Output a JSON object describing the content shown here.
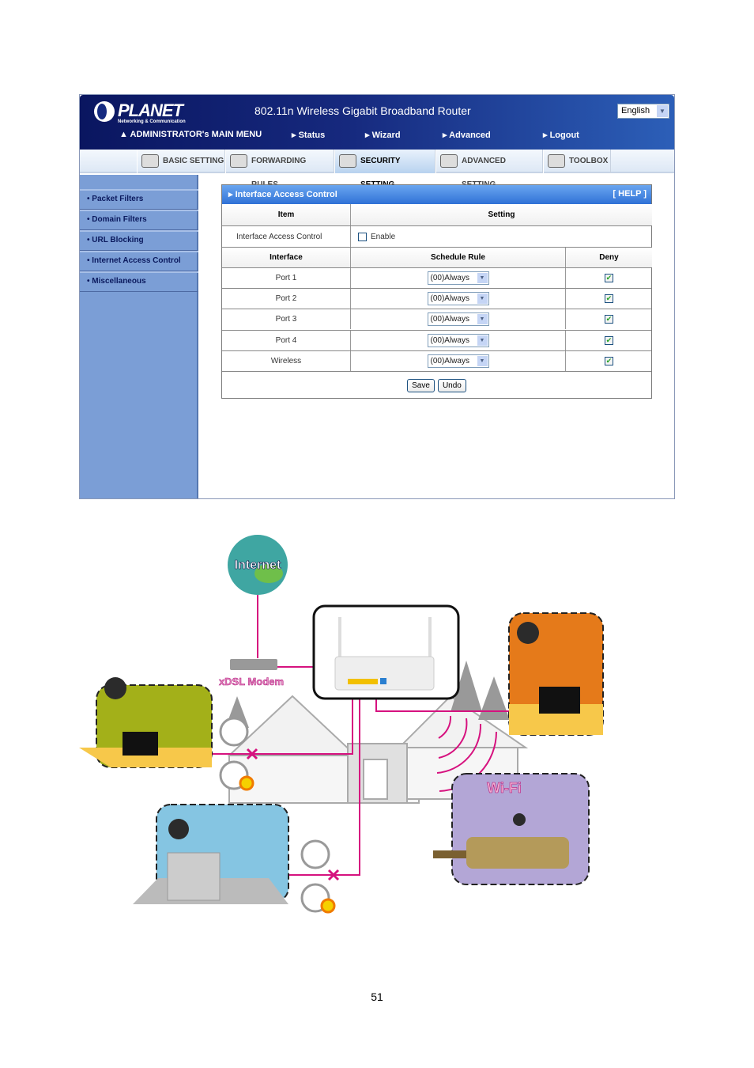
{
  "router_ui": {
    "brand": "PLANET",
    "brand_tagline": "Networking & Communication",
    "title": "802.11n Wireless Gigabit Broadband Router",
    "language": "English",
    "menu": {
      "admin": "ADMINISTRATOR's MAIN MENU",
      "items": [
        "Status",
        "Wizard",
        "Advanced",
        "Logout"
      ]
    },
    "tabs": [
      "BASIC SETTING",
      "FORWARDING RULES",
      "SECURITY SETTING",
      "ADVANCED SETTING",
      "TOOLBOX"
    ],
    "active_tab": "SECURITY SETTING",
    "sidebar": [
      "Packet Filters",
      "Domain Filters",
      "URL Blocking",
      "Internet Access Control",
      "Miscellaneous"
    ],
    "panel": {
      "title": "Interface Access Control",
      "help": "[ HELP ]",
      "col_item": "Item",
      "col_setting": "Setting",
      "iac_label": "Interface Access Control",
      "enable_label": "Enable",
      "enable_checked": false,
      "col_interface": "Interface",
      "col_schedule": "Schedule Rule",
      "col_deny": "Deny",
      "rows": [
        {
          "interface": "Port 1",
          "schedule": "(00)Always",
          "deny": true
        },
        {
          "interface": "Port 2",
          "schedule": "(00)Always",
          "deny": true
        },
        {
          "interface": "Port 3",
          "schedule": "(00)Always",
          "deny": true
        },
        {
          "interface": "Port 4",
          "schedule": "(00)Always",
          "deny": true
        },
        {
          "interface": "Wireless",
          "schedule": "(00)Always",
          "deny": true
        }
      ],
      "save": "Save",
      "undo": "Undo"
    }
  },
  "diagram": {
    "internet": "Internet",
    "modem": "xDSL Modem",
    "wifi": "Wi-Fi",
    "line_color": "#d6127f"
  },
  "page_number": "51"
}
